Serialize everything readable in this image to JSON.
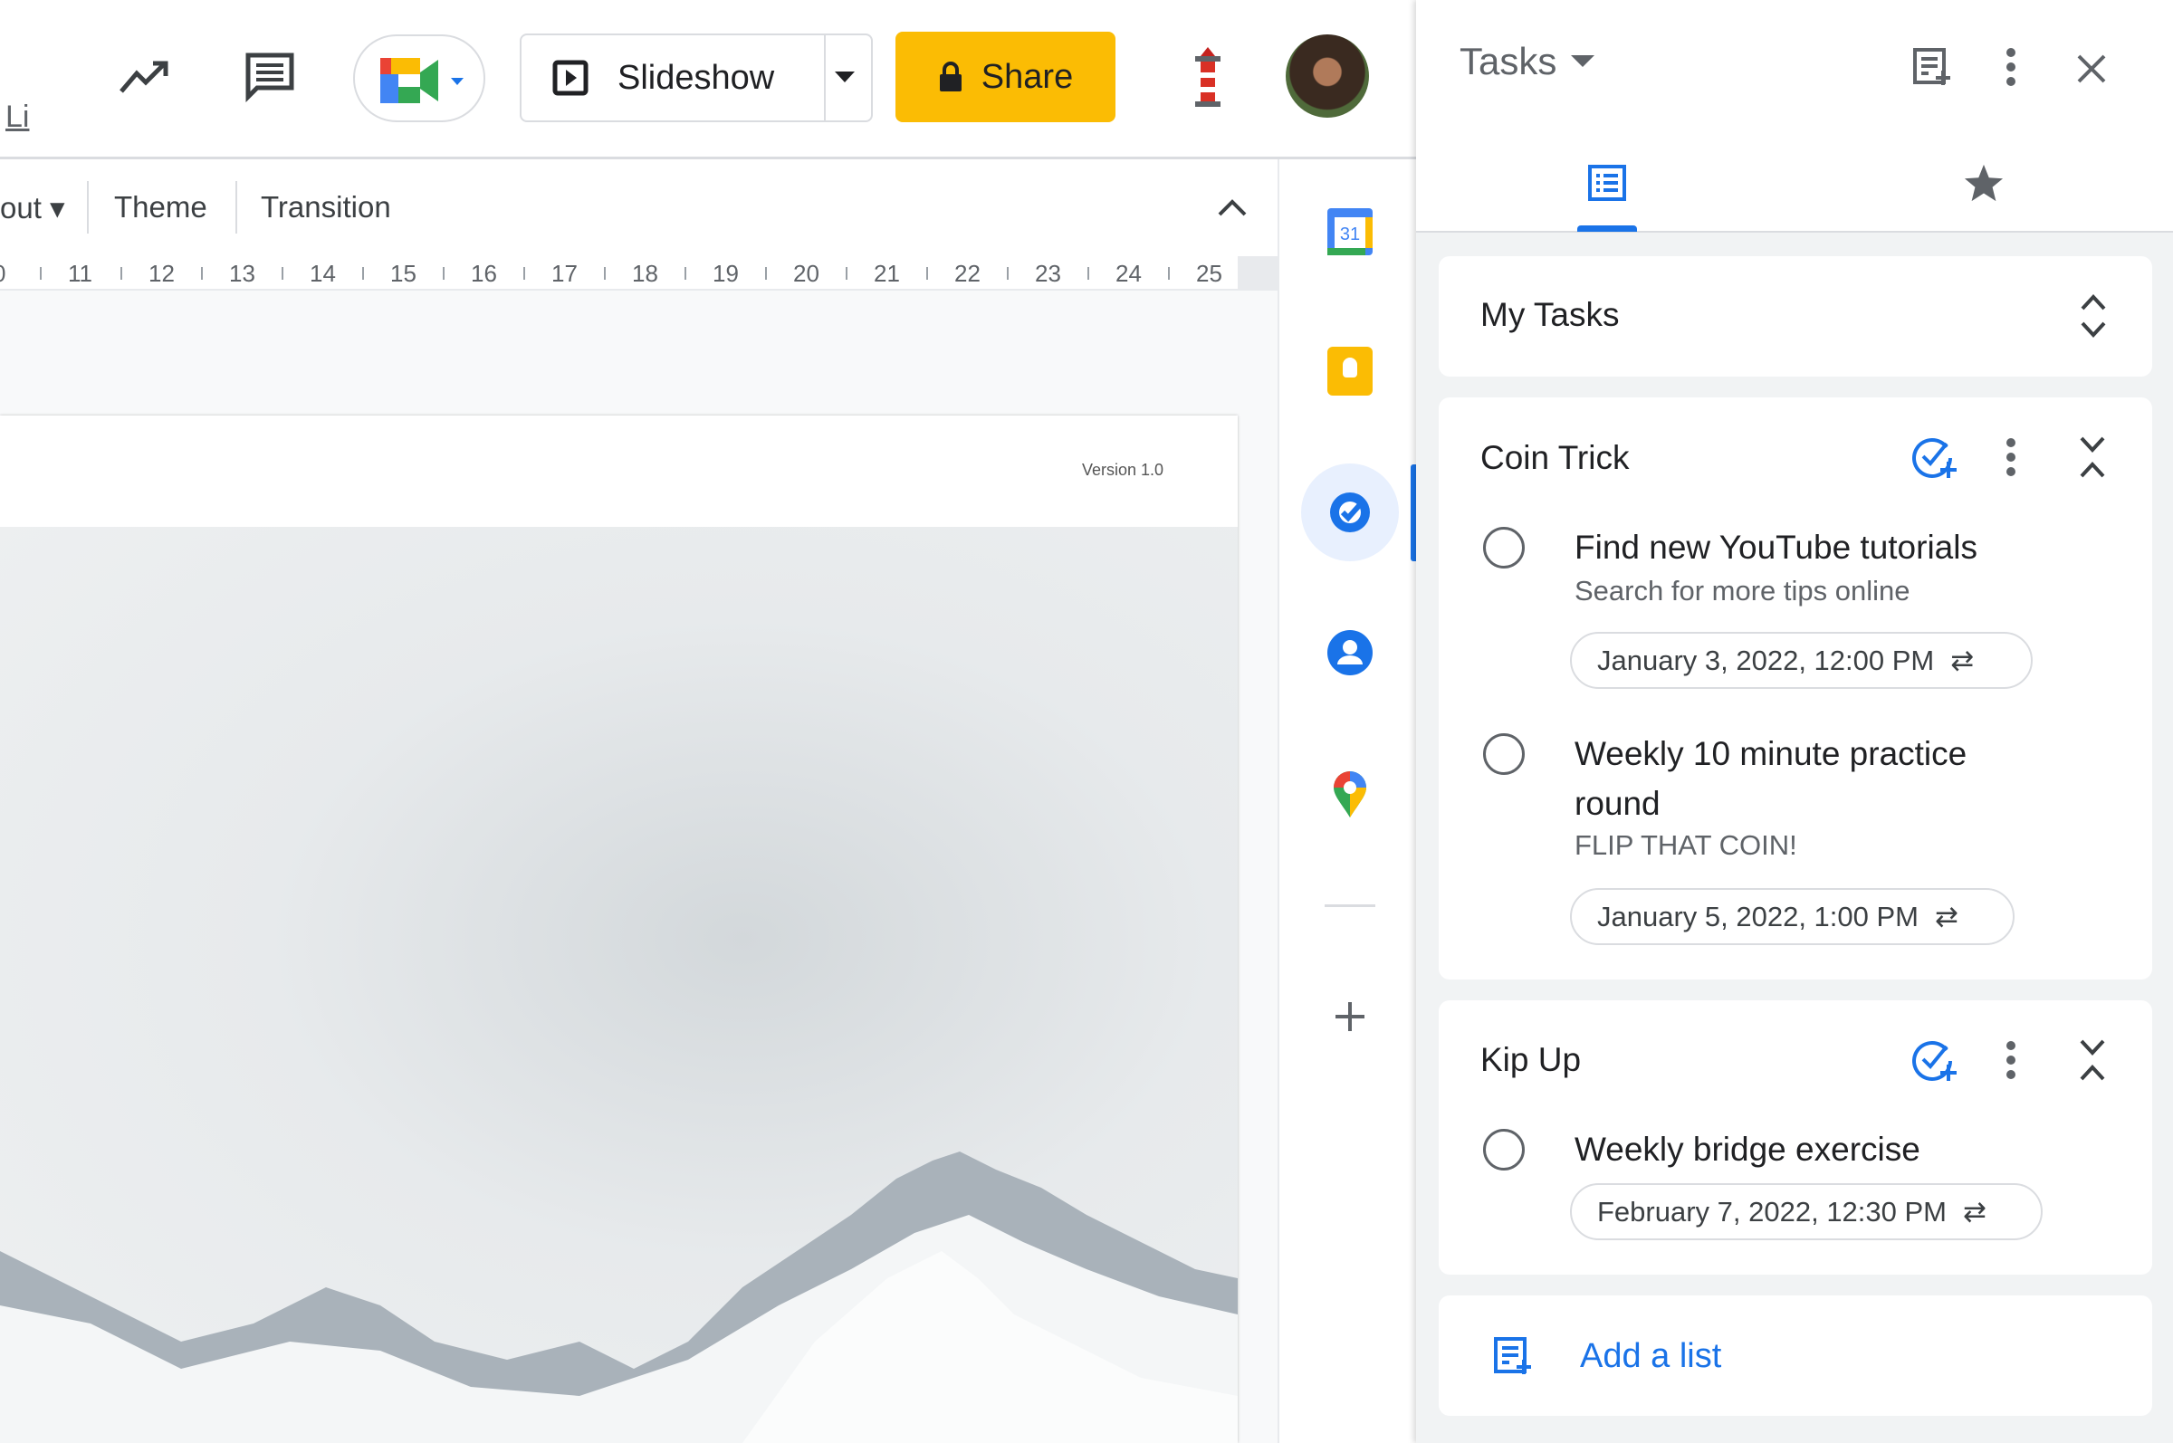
{
  "topbar": {
    "partial_label": "Li",
    "slideshow_label": "Slideshow",
    "share_label": "Share",
    "icons": [
      "trend-icon",
      "comment-icon",
      "meet-icon",
      "lighthouse-icon",
      "avatar"
    ],
    "share_color": "#fbbc04"
  },
  "toolbar": {
    "layout_partial": "out",
    "theme": "Theme",
    "transition": "Transition"
  },
  "ruler": {
    "ticks": [
      "0",
      "11",
      "12",
      "13",
      "14",
      "15",
      "16",
      "17",
      "18",
      "19",
      "20",
      "21",
      "22",
      "23",
      "24",
      "25"
    ]
  },
  "slide": {
    "version": "Version 1.0"
  },
  "rail": {
    "items": [
      "calendar",
      "keep",
      "tasks",
      "contacts",
      "maps"
    ],
    "active": "tasks"
  },
  "tasks": {
    "title": "Tasks",
    "accent": "#1a73e8",
    "list_selector": "My Tasks",
    "lists": [
      {
        "name": "Coin Trick",
        "tasks": [
          {
            "title": "Find new YouTube tutorials",
            "notes": "Search for more tips online",
            "due": "January 3, 2022, 12:00 PM",
            "repeat": true
          },
          {
            "title_line1": "Weekly 10 minute practice",
            "title_line2": "round",
            "notes": "FLIP THAT COIN!",
            "due": "January 5, 2022, 1:00 PM",
            "repeat": true
          }
        ]
      },
      {
        "name": "Kip Up",
        "tasks": [
          {
            "title": "Weekly bridge exercise",
            "due": "February 7, 2022, 12:30 PM",
            "repeat": true
          }
        ]
      }
    ],
    "add_list": "Add a list"
  }
}
